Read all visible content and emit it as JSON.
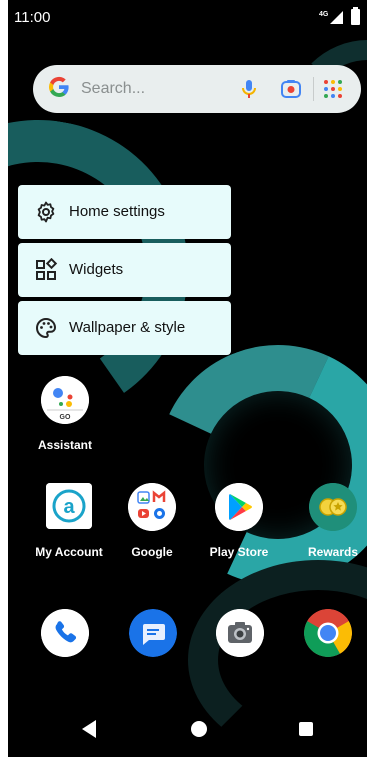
{
  "status_bar": {
    "time": "11:00",
    "network": "4G"
  },
  "search": {
    "placeholder": "Search..."
  },
  "menu": {
    "items": [
      {
        "label": "Home settings",
        "icon": "gear-icon"
      },
      {
        "label": "Widgets",
        "icon": "widgets-icon"
      },
      {
        "label": "Wallpaper & style",
        "icon": "palette-icon"
      }
    ]
  },
  "apps": {
    "assistant": {
      "label": "Assistant",
      "icon": "google-assistant-icon"
    },
    "row": [
      {
        "label": "My Account",
        "icon": "my-account-icon"
      },
      {
        "label": "Google",
        "icon": "google-folder-icon"
      },
      {
        "label": "Play Store",
        "icon": "play-store-icon"
      },
      {
        "label": "Rewards",
        "icon": "rewards-icon"
      }
    ]
  },
  "dock": [
    {
      "app": "phone",
      "icon": "phone-icon"
    },
    {
      "app": "messages",
      "icon": "messages-icon"
    },
    {
      "app": "camera",
      "icon": "camera-icon"
    },
    {
      "app": "chrome",
      "icon": "chrome-icon"
    }
  ],
  "colors": {
    "background": "#000000",
    "accent_teal": "#2aa6a6",
    "menu_bg": "#e7fbfb"
  }
}
